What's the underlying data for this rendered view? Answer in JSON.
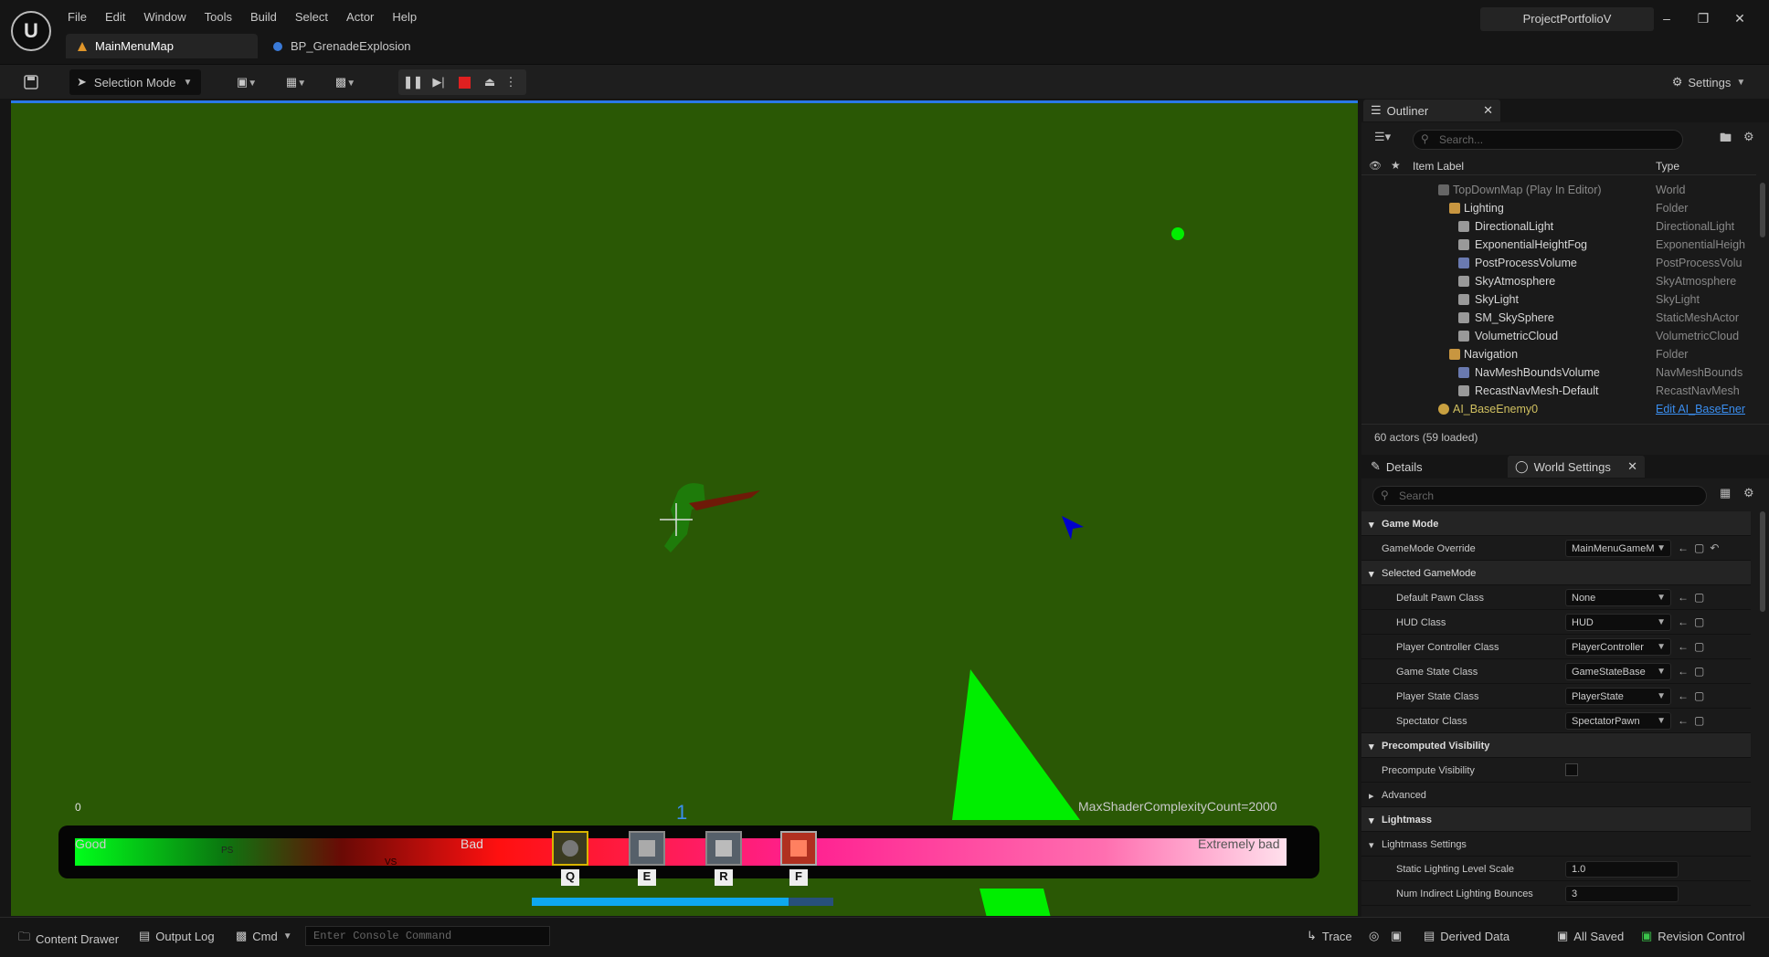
{
  "menu": [
    "File",
    "Edit",
    "Window",
    "Tools",
    "Build",
    "Select",
    "Actor",
    "Help"
  ],
  "tabs": [
    {
      "label": "MainMenuMap"
    },
    {
      "label": "BP_GrenadeExplosion"
    }
  ],
  "project_name": "ProjectPortfolioV",
  "toolbar": {
    "selection_mode": "Selection Mode",
    "settings": "Settings"
  },
  "viewport": {
    "zero_label": "0",
    "index_label": "1",
    "max_shader": "MaxShaderComplexityCount=2000",
    "complexity_labels": {
      "good": "Good",
      "bad": "Bad",
      "extremely_bad": "Extremely bad",
      "ps": "PS",
      "vs": "VS"
    },
    "abilities": [
      {
        "key": "Q"
      },
      {
        "key": "E"
      },
      {
        "key": "R"
      },
      {
        "key": "F"
      }
    ],
    "progress_fraction": 0.85,
    "colors": {
      "background": "#2a5805",
      "bright_green": "#00ee00",
      "pointer": "#0000cc"
    }
  },
  "outliner": {
    "tab": "Outliner",
    "search_placeholder": "Search...",
    "col_label": "Item Label",
    "col_type": "Type",
    "rows": [
      {
        "label": "TopDownMap (Play In Editor)",
        "type": "World"
      },
      {
        "label": "Lighting",
        "type": "Folder"
      },
      {
        "label": "DirectionalLight",
        "type": "DirectionalLight"
      },
      {
        "label": "ExponentialHeightFog",
        "type": "ExponentialHeigh"
      },
      {
        "label": "PostProcessVolume",
        "type": "PostProcessVolu"
      },
      {
        "label": "SkyAtmosphere",
        "type": "SkyAtmosphere"
      },
      {
        "label": "SkyLight",
        "type": "SkyLight"
      },
      {
        "label": "SM_SkySphere",
        "type": "StaticMeshActor"
      },
      {
        "label": "VolumetricCloud",
        "type": "VolumetricCloud"
      },
      {
        "label": "Navigation",
        "type": "Folder"
      },
      {
        "label": "NavMeshBoundsVolume",
        "type": "NavMeshBounds"
      },
      {
        "label": "RecastNavMesh-Default",
        "type": "RecastNavMesh"
      },
      {
        "label": "AI_BaseEnemy0",
        "type": "Edit AI_BaseEner"
      }
    ],
    "count": "60 actors (59 loaded)"
  },
  "details": {
    "tab_details": "Details",
    "tab_world": "World Settings",
    "search_placeholder": "Search",
    "rows": [
      {
        "label": "Game Mode",
        "section": true
      },
      {
        "label": "GameMode Override",
        "value": "MainMenuGameM"
      },
      {
        "label": "Selected GameMode",
        "section": true
      },
      {
        "label": "Default Pawn Class",
        "value": "None"
      },
      {
        "label": "HUD Class",
        "value": "HUD"
      },
      {
        "label": "Player Controller Class",
        "value": "PlayerController"
      },
      {
        "label": "Game State Class",
        "value": "GameStateBase"
      },
      {
        "label": "Player State Class",
        "value": "PlayerState"
      },
      {
        "label": "Spectator Class",
        "value": "SpectatorPawn"
      },
      {
        "label": "Precomputed Visibility",
        "section": true
      },
      {
        "label": "Precompute Visibility",
        "checkbox": true
      },
      {
        "label": "Advanced",
        "section": true
      },
      {
        "label": "Lightmass",
        "section": true
      },
      {
        "label": "Lightmass Settings",
        "section": true
      },
      {
        "label": "Static Lighting Level Scale",
        "num": "1.0"
      },
      {
        "label": "Num Indirect Lighting Bounces",
        "num": "3"
      }
    ]
  },
  "statusbar": {
    "content_drawer": "Content Drawer",
    "output_log": "Output Log",
    "cmd": "Cmd",
    "console_placeholder": "Enter Console Command",
    "trace": "Trace",
    "derived_data": "Derived Data",
    "all_saved": "All Saved",
    "revision_control": "Revision Control"
  }
}
